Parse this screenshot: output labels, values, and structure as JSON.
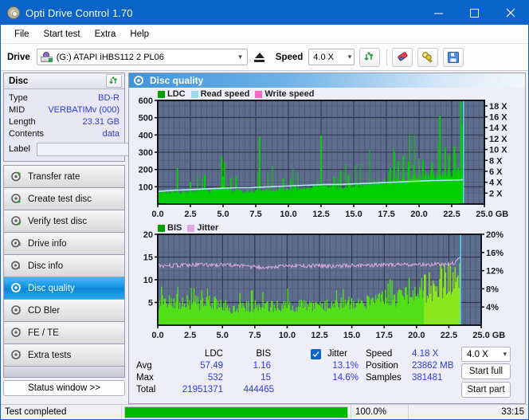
{
  "window": {
    "title": "Opti Drive Control 1.70",
    "icon": "disc-icon",
    "controls": {
      "minimize": "–",
      "maximize": "☐",
      "close": "✕"
    }
  },
  "menu": {
    "items": [
      "File",
      "Start test",
      "Extra",
      "Help"
    ]
  },
  "toolbar": {
    "drive_label": "Drive",
    "drive_value": "(G:)   ATAPI iHBS112  2 PL06",
    "eject_title": "Eject",
    "speed_label": "Speed",
    "speed_value": "4.0 X",
    "icons": [
      "refresh-icon",
      "eraser-icon",
      "keys-icon",
      "save-icon"
    ]
  },
  "disc": {
    "title": "Disc",
    "refresh_icon": "refresh-icon",
    "rows": [
      {
        "key": "Type",
        "value": "BD-R"
      },
      {
        "key": "MID",
        "value": "VERBATIMv (000)"
      },
      {
        "key": "Length",
        "value": "23.31 GB"
      },
      {
        "key": "Contents",
        "value": "data"
      }
    ],
    "label_key": "Label",
    "label_value": "",
    "label_placeholder": ""
  },
  "nav": {
    "items": [
      {
        "label": "Transfer rate",
        "icon": "disc-test-icon",
        "active": false
      },
      {
        "label": "Create test disc",
        "icon": "disc-burn-icon",
        "active": false
      },
      {
        "label": "Verify test disc",
        "icon": "disc-check-icon",
        "active": false
      },
      {
        "label": "Drive info",
        "icon": "disc-info-icon",
        "active": false
      },
      {
        "label": "Disc info",
        "icon": "disc-info2-icon",
        "active": false
      },
      {
        "label": "Disc quality",
        "icon": "disc-quality-icon",
        "active": true
      },
      {
        "label": "CD Bler",
        "icon": "disc-bler-icon",
        "active": false
      },
      {
        "label": "FE / TE",
        "icon": "disc-fete-icon",
        "active": false
      },
      {
        "label": "Extra tests",
        "icon": "disc-extra-icon",
        "active": false
      }
    ],
    "status_window_button": "Status window >>"
  },
  "panel": {
    "title": "Disc quality",
    "icon": "disc-quality-icon"
  },
  "chart_data": [
    {
      "type": "area",
      "id": "ldc-chart",
      "title": "",
      "legend": [
        {
          "name": "LDC",
          "color": "#00a000"
        },
        {
          "name": "Read speed",
          "color": "#9fd8f2"
        },
        {
          "name": "Write speed",
          "color": "#ff66cc"
        }
      ],
      "legend_position": "top-left",
      "xlabel": "GB",
      "x_ticks": [
        "0.0",
        "2.5",
        "5.0",
        "7.5",
        "10.0",
        "12.5",
        "15.0",
        "17.5",
        "20.0",
        "22.5",
        "25.0"
      ],
      "xlim": [
        0,
        25
      ],
      "ylabel_left": "",
      "y_ticks_left": [
        "600",
        "500",
        "400",
        "300",
        "200",
        "100"
      ],
      "ylim_left": [
        0,
        600
      ],
      "ylabel_right": "",
      "y_ticks_right": [
        "18 X",
        "16 X",
        "14 X",
        "12 X",
        "10 X",
        "8 X",
        "6 X",
        "4 X",
        "2 X"
      ],
      "ylim_right": [
        0,
        19
      ],
      "grid": true,
      "plot_bg": "#5e6d8d",
      "data_end_gb": 23.4,
      "series": [
        {
          "name": "LDC",
          "color": "#00d000",
          "type": "area-spikes",
          "x": [
            0.0,
            0.6,
            1.2,
            1.8,
            2.4,
            3.0,
            3.6,
            4.2,
            4.8,
            5.2,
            5.8,
            6.4,
            7.0,
            7.6,
            8.2,
            8.8,
            9.4,
            10.0,
            10.6,
            11.2,
            11.8,
            12.4,
            13.0,
            13.6,
            14.2,
            14.8,
            15.4,
            16.0,
            16.6,
            17.2,
            17.8,
            18.4,
            19.0,
            19.6,
            20.2,
            20.8,
            21.4,
            22.0,
            22.6,
            23.2,
            23.4
          ],
          "values": [
            60,
            66,
            72,
            70,
            74,
            78,
            80,
            78,
            84,
            95,
            72,
            70,
            74,
            72,
            76,
            80,
            84,
            86,
            90,
            92,
            96,
            98,
            100,
            96,
            100,
            104,
            110,
            114,
            120,
            124,
            132,
            140,
            146,
            152,
            158,
            164,
            166,
            170,
            176,
            182,
            185
          ],
          "spikes": [
            {
              "x": 1.5,
              "v": 208
            },
            {
              "x": 2.5,
              "v": 128
            },
            {
              "x": 3.6,
              "v": 170
            },
            {
              "x": 4.9,
              "v": 275
            },
            {
              "x": 5.1,
              "v": 240
            },
            {
              "x": 5.6,
              "v": 150
            },
            {
              "x": 6.0,
              "v": 160
            },
            {
              "x": 7.8,
              "v": 390
            },
            {
              "x": 9.6,
              "v": 150
            },
            {
              "x": 10.2,
              "v": 140
            },
            {
              "x": 12.5,
              "v": 398
            },
            {
              "x": 13.5,
              "v": 160
            },
            {
              "x": 14.0,
              "v": 190
            },
            {
              "x": 14.6,
              "v": 170
            },
            {
              "x": 17.8,
              "v": 210
            },
            {
              "x": 18.1,
              "v": 300
            },
            {
              "x": 18.4,
              "v": 250
            },
            {
              "x": 18.8,
              "v": 280
            },
            {
              "x": 19.2,
              "v": 245
            },
            {
              "x": 19.6,
              "v": 230
            },
            {
              "x": 20.3,
              "v": 255
            },
            {
              "x": 21.0,
              "v": 240
            },
            {
              "x": 21.6,
              "v": 510
            },
            {
              "x": 22.0,
              "v": 330
            },
            {
              "x": 22.3,
              "v": 290
            },
            {
              "x": 22.7,
              "v": 335
            },
            {
              "x": 23.2,
              "v": 600
            }
          ]
        },
        {
          "name": "Read speed",
          "color": "#b4e3fa",
          "type": "line",
          "axis": "right",
          "x": [
            0.0,
            1.0,
            2.0,
            3.0,
            4.0,
            5.0,
            6.0,
            7.0,
            8.0,
            9.0,
            10.0,
            11.0,
            12.0,
            13.0,
            14.0,
            15.0,
            16.0,
            17.0,
            18.0,
            19.0,
            20.0,
            21.0,
            22.0,
            23.0,
            23.4
          ],
          "values": [
            2.3,
            2.5,
            2.6,
            2.7,
            2.8,
            2.9,
            3.0,
            3.0,
            3.1,
            3.2,
            3.3,
            3.4,
            3.5,
            3.6,
            3.6,
            3.7,
            3.8,
            3.9,
            4.0,
            4.1,
            4.2,
            4.3,
            4.35,
            4.4,
            4.45
          ]
        },
        {
          "name": "Write speed",
          "color": "#ff66cc",
          "type": "line",
          "x": [],
          "values": []
        }
      ]
    },
    {
      "type": "bar",
      "id": "bis-chart",
      "title": "",
      "legend": [
        {
          "name": "BIS",
          "color": "#00a000"
        },
        {
          "name": "Jitter",
          "color": "#e0a8e0"
        }
      ],
      "legend_position": "top-left",
      "xlabel": "GB",
      "x_ticks": [
        "0.0",
        "2.5",
        "5.0",
        "7.5",
        "10.0",
        "12.5",
        "15.0",
        "17.5",
        "20.0",
        "22.5",
        "25.0"
      ],
      "xlim": [
        0,
        25
      ],
      "y_ticks_left": [
        "20",
        "15",
        "10",
        "5"
      ],
      "ylim_left": [
        0,
        20
      ],
      "y_ticks_right": [
        "20%",
        "16%",
        "12%",
        "8%",
        "4%"
      ],
      "ylim_right": [
        0,
        20
      ],
      "grid": true,
      "plot_bg": "#5e6d8d",
      "data_end_gb": 23.4,
      "series": [
        {
          "name": "BIS",
          "color": "#52e016",
          "type": "bars",
          "x": [
            0.0,
            0.8,
            1.6,
            2.4,
            3.2,
            4.0,
            4.8,
            5.6,
            6.4,
            7.2,
            8.0,
            8.8,
            9.6,
            10.4,
            11.2,
            12.0,
            12.8,
            13.6,
            14.4,
            15.2,
            16.0,
            16.8,
            17.6,
            18.4,
            19.2,
            20.0,
            20.8,
            21.6,
            22.4,
            23.2
          ],
          "values": [
            6.2,
            6.0,
            6.1,
            5.9,
            5.8,
            5.9,
            5.6,
            4.6,
            4.6,
            4.8,
            5.2,
            5.0,
            5.0,
            5.1,
            5.2,
            5.0,
            5.3,
            5.4,
            5.6,
            5.8,
            6.0,
            6.4,
            7.0,
            7.2,
            7.8,
            8.2,
            8.8,
            9.6,
            11.2,
            13.6
          ],
          "peaks": [
            8.0,
            9.5,
            8.6,
            8.2,
            9.0,
            8.4,
            9.2,
            6.6,
            7.2,
            9.1,
            8.2,
            7.6,
            7.8,
            8.0,
            7.9,
            8.2,
            8.4,
            8.3,
            8.6,
            9.0,
            9.4,
            10.1,
            9.6,
            10.3,
            11.0,
            10.8,
            11.4,
            13.1,
            14.0,
            15.0
          ]
        },
        {
          "name": "Jitter",
          "color": "#dba8dd",
          "type": "line",
          "axis": "right",
          "x": [
            0.0,
            1.0,
            2.0,
            3.0,
            4.0,
            5.0,
            6.0,
            7.0,
            8.0,
            9.0,
            10.0,
            11.0,
            12.0,
            13.0,
            14.0,
            15.0,
            16.0,
            17.0,
            18.0,
            19.0,
            20.0,
            21.0,
            22.0,
            23.0,
            23.4
          ],
          "values": [
            13.0,
            13.1,
            13.2,
            13.3,
            13.2,
            13.3,
            13.1,
            12.9,
            12.8,
            12.9,
            13.0,
            13.0,
            13.1,
            13.0,
            13.0,
            13.1,
            13.2,
            13.2,
            13.3,
            13.3,
            13.4,
            13.4,
            13.3,
            13.8,
            15.0
          ]
        }
      ]
    }
  ],
  "stats": {
    "col_headers": [
      "LDC",
      "BIS"
    ],
    "row_headers": [
      "Avg",
      "Max",
      "Total"
    ],
    "ldc": {
      "avg": "57.49",
      "max": "532",
      "total": "21951371"
    },
    "bis": {
      "avg": "1.16",
      "max": "15",
      "total": "444465"
    },
    "jitter": {
      "label": "Jitter",
      "checked": true,
      "avg": "13.1%",
      "max": "14.6%"
    },
    "right": [
      {
        "key": "Speed",
        "value": "4.18 X"
      },
      {
        "key": "Position",
        "value": "23862 MB"
      },
      {
        "key": "Samples",
        "value": "381481"
      }
    ],
    "speed_select": "4.0 X",
    "start_full_button": "Start full",
    "start_part_button": "Start part"
  },
  "statusbar": {
    "message": "Test completed",
    "progress_percent": 100.0,
    "progress_text": "100.0%",
    "elapsed": "33:15",
    "progress_color": "#00b700"
  }
}
